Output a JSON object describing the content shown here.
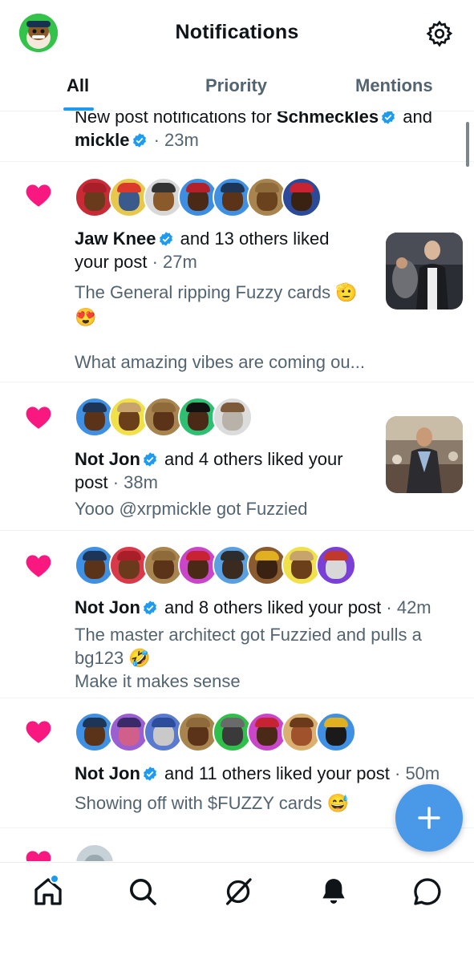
{
  "header": {
    "title": "Notifications"
  },
  "tabs": [
    {
      "label": "All",
      "active": true
    },
    {
      "label": "Priority",
      "active": false
    },
    {
      "label": "Mentions",
      "active": false
    }
  ],
  "colors": {
    "accent": "#1d9bf0",
    "heart": "#f91880",
    "fab": "#4a99e9",
    "muted": "#536471"
  },
  "notifications": [
    {
      "type": "new_post",
      "prefix": "New post notifications for ",
      "name1": "Schmeckles",
      "mid": " and",
      "name2": "mickle",
      "time": " · 23m"
    },
    {
      "type": "like",
      "actor": "Jaw Knee",
      "text_a": " and 13 others liked",
      "text_b": "your post",
      "time": " · 27m",
      "snippet1": "The General ripping Fuzzy cards 🫡",
      "snippet2": "😍",
      "snippet3": "What amazing vibes are coming ou..."
    },
    {
      "type": "like",
      "actor": "Not Jon",
      "text_a": " and 4 others liked your",
      "text_b": "post",
      "time": " · 38m",
      "snippet1": "Yooo @xrpmickle got Fuzzied"
    },
    {
      "type": "like",
      "actor": "Not Jon",
      "text_a": " and 8 others liked your post",
      "time": " · 42m",
      "snippet1": "The master architect got Fuzzied and pulls a",
      "snippet2": "bg123 🤣",
      "snippet3": "Make it makes sense"
    },
    {
      "type": "like",
      "actor": "Not Jon",
      "text_a": " and 11 others liked your post",
      "time": " · 50m",
      "snippet1": "Showing off with $FUZZY cards 😅"
    }
  ],
  "fab": {
    "icon": "plus-icon"
  },
  "bottom_nav": [
    {
      "icon": "home-icon"
    },
    {
      "icon": "search-icon"
    },
    {
      "icon": "grok-icon"
    },
    {
      "icon": "bell-icon"
    },
    {
      "icon": "messages-icon"
    }
  ]
}
